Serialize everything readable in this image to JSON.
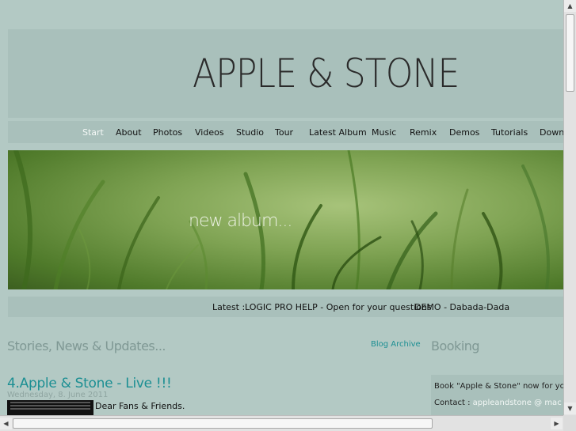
{
  "site": {
    "title": "APPLE & STONE"
  },
  "nav": {
    "items": [
      {
        "label": "Start",
        "active": true
      },
      {
        "label": "About"
      },
      {
        "label": "Photos"
      },
      {
        "label": "Videos"
      },
      {
        "label": "Studio"
      },
      {
        "label": "Tour"
      },
      {
        "label": "Latest Album"
      },
      {
        "label": "Music"
      },
      {
        "label": "Remix"
      },
      {
        "label": "Demos"
      },
      {
        "label": "Tutorials"
      },
      {
        "label": "Downlo"
      }
    ]
  },
  "hero": {
    "text": "new album..."
  },
  "latest": {
    "label": "Latest :",
    "links": [
      "LOGIC PRO HELP - Open for your questions",
      "DEMO - Dabada-Dada"
    ]
  },
  "main": {
    "section_title": "Stories, News & Updates...",
    "archive_link": "Blog Archive",
    "post": {
      "title": "4.Apple & Stone - Live !!!",
      "date": "Wednesday, 8. June 2011",
      "text": "Dear Fans & Friends."
    }
  },
  "booking": {
    "title": "Booking",
    "line1": "Book \"Apple & Stone\" now for you",
    "contact_label": "Contact :",
    "email": "appleandstone @ mac"
  },
  "colors": {
    "background": "#b3c9c4",
    "band": "#a9c0bb",
    "link_accent": "#1c8f93",
    "heading_muted": "#7f9894"
  }
}
